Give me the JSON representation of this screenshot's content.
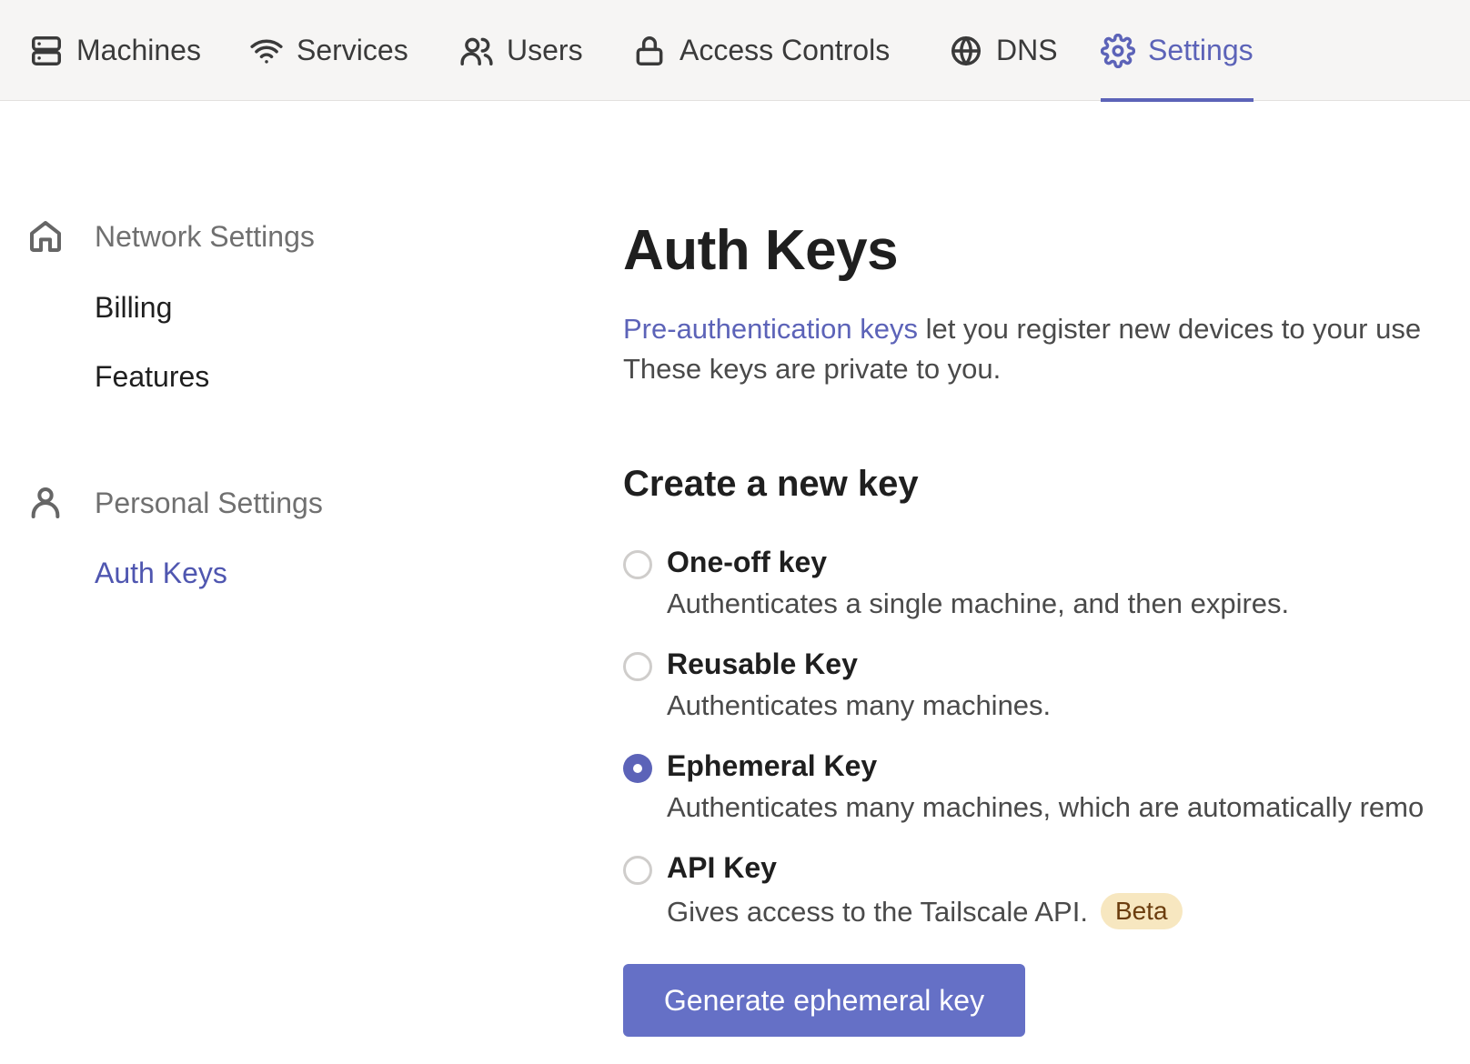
{
  "topnav": {
    "items": [
      {
        "label": "Machines",
        "icon": "server-icon"
      },
      {
        "label": "Services",
        "icon": "wifi-icon"
      },
      {
        "label": "Users",
        "icon": "users-icon"
      },
      {
        "label": "Access Controls",
        "icon": "lock-icon"
      },
      {
        "label": "DNS",
        "icon": "globe-icon"
      },
      {
        "label": "Settings",
        "icon": "gear-icon",
        "active": true
      }
    ]
  },
  "sidebar": {
    "network": {
      "heading": "Network Settings",
      "icon": "home-icon",
      "links": [
        "Billing",
        "Features"
      ]
    },
    "personal": {
      "heading": "Personal Settings",
      "icon": "user-icon",
      "links": [
        "Auth Keys"
      ],
      "active": "Auth Keys"
    }
  },
  "main": {
    "title": "Auth Keys",
    "intro_link": "Pre-authentication keys",
    "intro_rest": " let you register new devices to your use",
    "intro_line2": "These keys are private to you.",
    "section_title": "Create a new key",
    "options": [
      {
        "label": "One-off key",
        "description": "Authenticates a single machine, and then expires.",
        "checked": false
      },
      {
        "label": "Reusable Key",
        "description": "Authenticates many machines.",
        "checked": false
      },
      {
        "label": "Ephemeral Key",
        "description": "Authenticates many machines, which are automatically remo",
        "checked": true
      },
      {
        "label": "API Key",
        "description": "Gives access to the Tailscale API.",
        "badge": "Beta",
        "checked": false
      }
    ],
    "generate_button": "Generate ephemeral key"
  },
  "colors": {
    "accent": "#5c63b8",
    "button": "#6570c6",
    "badge_bg": "#f7e7c0",
    "badge_text": "#6b3d0e"
  }
}
